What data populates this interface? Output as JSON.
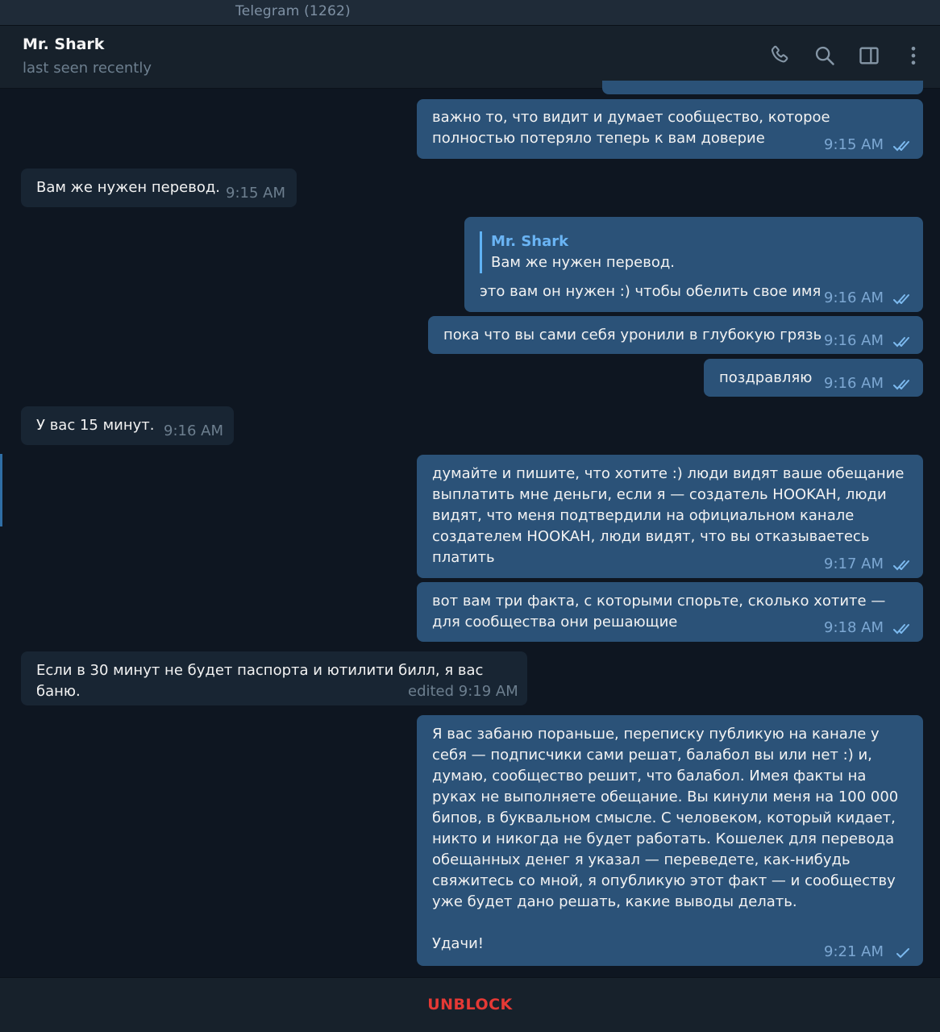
{
  "window": {
    "title": "Telegram (1262)"
  },
  "header": {
    "name": "Mr. Shark",
    "status": "last seen recently",
    "icons": [
      "phone-icon",
      "search-icon",
      "sidebar-toggle-icon",
      "more-vert-icon"
    ]
  },
  "colors": {
    "background": "#0e1621",
    "outgoing_bubble": "#2b5278",
    "incoming_bubble": "#182533",
    "unblock": "#e53935",
    "reply_accent": "#5fb3f5"
  },
  "messages": [
    {
      "direction": "out",
      "text": "важно то, что видит и думает сообщество, которое полностью потеряло теперь к вам доверие",
      "time": "9:15 AM",
      "ticks": "double"
    },
    {
      "direction": "in",
      "text": "Вам же нужен перевод.",
      "time": "9:15 AM"
    },
    {
      "direction": "out",
      "reply_name": "Mr. Shark",
      "reply_text": "Вам же нужен перевод.",
      "text": "это вам он нужен :) чтобы обелить свое имя",
      "time": "9:16 AM",
      "ticks": "double"
    },
    {
      "direction": "out",
      "text": "пока что вы сами себя уронили в глубокую грязь",
      "time": "9:16 AM",
      "ticks": "double"
    },
    {
      "direction": "out",
      "text": "поздравляю",
      "time": "9:16 AM",
      "ticks": "double"
    },
    {
      "direction": "in",
      "text": "У вас 15 минут.",
      "time": "9:16 AM"
    },
    {
      "direction": "out",
      "text": "думайте и пишите, что хотите :) люди видят ваше обещание выплатить мне деньги, если я — создатель HOOKAH, люди видят, что меня подтвердили на официальном канале создателем HOOKAH, люди видят, что вы отказываетесь платить",
      "time": "9:17 AM",
      "ticks": "double"
    },
    {
      "direction": "out",
      "text": "вот вам три факта, с которыми спорьте, сколько хотите — для сообщества они решающие",
      "time": "9:18 AM",
      "ticks": "double"
    },
    {
      "direction": "in",
      "text": "Если в 30 минут не будет паспорта и ютилити билл, я вас баню.",
      "time": "edited 9:19 AM"
    },
    {
      "direction": "out",
      "text": "Я вас забаню пораньше, переписку публикую на канале у себя — подписчики сами решат, балабол вы или нет :) и, думаю, сообщество решит, что балабол. Имея факты на руках не выполняете обещание. Вы кинули меня на 100 000 бипов, в буквальном смысле. С человеком, который кидает, никто и никогда не будет работать. Кошелек для перевода обещанных денег я указал — переведете, как-нибудь свяжитесь со мной, я опубликую этот факт — и сообществу уже будет дано решать, какие выводы делать.\n\nУдачи!",
      "time": "9:21 AM",
      "ticks": "single"
    }
  ],
  "footer": {
    "unblock_label": "UNBLOCK"
  }
}
